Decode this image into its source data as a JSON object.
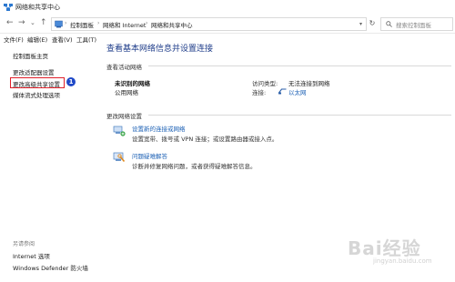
{
  "window": {
    "title": "网络和共享中心"
  },
  "nav": {
    "back": "←",
    "forward": "→",
    "recent": "⌄",
    "up": "↑"
  },
  "address": {
    "crumbs": [
      "控制面板",
      "网络和 Internet",
      "网络和共享中心"
    ],
    "separator": "›"
  },
  "search": {
    "placeholder": "搜索控制面板"
  },
  "menu": {
    "items": [
      "文件(F)",
      "编辑(E)",
      "查看(V)",
      "工具(T)"
    ]
  },
  "sidebar": {
    "home": "控制面板主页",
    "items": [
      "更改适配器设置",
      "更改高级共享设置",
      "媒体流式处理选项"
    ],
    "badge": "1",
    "see_also_title": "另请参阅",
    "see_also": [
      "Internet 选项",
      "Windows Defender 防火墙"
    ]
  },
  "main": {
    "title": "查看基本网络信息并设置连接",
    "active_section": "查看活动网络",
    "network_name": "未识别的网络",
    "network_type": "公用网络",
    "access_type_label": "访问类型:",
    "access_type_value": "无法连接到网络",
    "connection_label": "连接:",
    "connection_value": "以太网",
    "change_section": "更改网络设置",
    "new_connection_title": "设置新的连接或网络",
    "new_connection_desc": "设置宽带、拨号或 VPN 连接；或设置路由器或接入点。",
    "troubleshoot_title": "问题疑难解答",
    "troubleshoot_desc": "诊断并修复网络问题，或者获得疑难解答信息。"
  },
  "watermark": {
    "text": "Bai经验",
    "sub": "jingyan.baidu.com"
  },
  "colors": {
    "link": "#1a5fb4",
    "title": "#1f3d8a",
    "highlight": "#e0202a",
    "badge": "#1f49c8"
  }
}
